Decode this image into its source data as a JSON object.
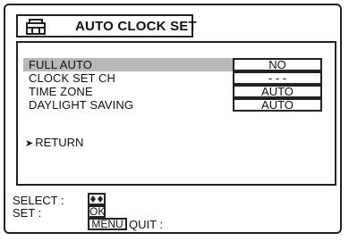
{
  "title": {
    "icon": "tv-menu-icon",
    "text": "AUTO CLOCK SET"
  },
  "menu": {
    "items": [
      {
        "label": "FULL AUTO",
        "value": "NO",
        "selected": true
      },
      {
        "label": "CLOCK SET CH",
        "value": "- - -",
        "selected": false
      },
      {
        "label": "TIME ZONE",
        "value": "AUTO",
        "selected": false
      },
      {
        "label": "DAYLIGHT SAVING",
        "value": "AUTO",
        "selected": false
      }
    ],
    "return_label": "RETURN",
    "return_icon": "arrow-right-icon"
  },
  "footer": {
    "select_label": "SELECT :",
    "select_key_icon": "up-down-arrows-icon",
    "set_label": "SET :",
    "set_key": "OK",
    "quit_key": "MENU",
    "quit_label": "QUIT :"
  },
  "colors": {
    "highlight": "#b8b8b8",
    "border": "#222222"
  }
}
